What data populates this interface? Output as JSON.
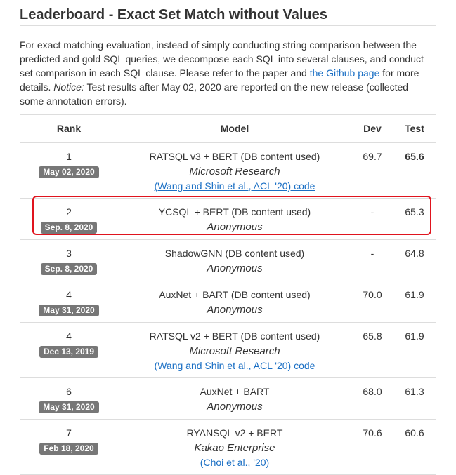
{
  "page": {
    "title": "Leaderboard - Exact Set Match without Values",
    "intro_part1": "For exact matching evaluation, instead of simply conducting string comparison between the predicted and gold SQL queries, we decompose each SQL into several clauses, and conduct set comparison in each SQL clause. Please refer to the paper and ",
    "intro_link": "the Github page",
    "intro_part2": " for more details. ",
    "intro_notice": "Notice:",
    "intro_part3": " Test results after May 02, 2020 are reported on the new release (collected some annotation errors).",
    "link_color": "#1a6fc4",
    "highlight_color": "#e0141e",
    "badge_color": "#777777"
  },
  "table": {
    "headers": {
      "rank": "Rank",
      "model": "Model",
      "dev": "Dev",
      "test": "Test"
    },
    "rows": [
      {
        "rank": "1",
        "date": "May 02, 2020",
        "model": "RATSQL v3 + BERT (DB content used)",
        "org": "Microsoft Research",
        "link": "(Wang and Shin et al., ACL '20) code",
        "dev": "69.7",
        "test": "65.6"
      },
      {
        "rank": "2",
        "date": "Sep. 8, 2020",
        "model": "YCSQL + BERT (DB content used)",
        "org": "Anonymous",
        "link": "",
        "dev": "-",
        "test": "65.3"
      },
      {
        "rank": "3",
        "date": "Sep. 8, 2020",
        "model": "ShadowGNN (DB content used)",
        "org": "Anonymous",
        "link": "",
        "dev": "-",
        "test": "64.8"
      },
      {
        "rank": "4",
        "date": "May 31, 2020",
        "model": "AuxNet + BART (DB content used)",
        "org": "Anonymous",
        "link": "",
        "dev": "70.0",
        "test": "61.9"
      },
      {
        "rank": "4",
        "date": "Dec 13, 2019",
        "model": "RATSQL v2 + BERT (DB content used)",
        "org": "Microsoft Research",
        "link": "(Wang and Shin et al., ACL '20) code",
        "dev": "65.8",
        "test": "61.9"
      },
      {
        "rank": "6",
        "date": "May 31, 2020",
        "model": "AuxNet + BART",
        "org": "Anonymous",
        "link": "",
        "dev": "68.0",
        "test": "61.3"
      },
      {
        "rank": "7",
        "date": "Feb 18, 2020",
        "model": "RYANSQL v2 + BERT",
        "org": "Kakao Enterprise",
        "link": "(Choi et al., '20)",
        "dev": "70.6",
        "test": "60.6"
      }
    ]
  }
}
